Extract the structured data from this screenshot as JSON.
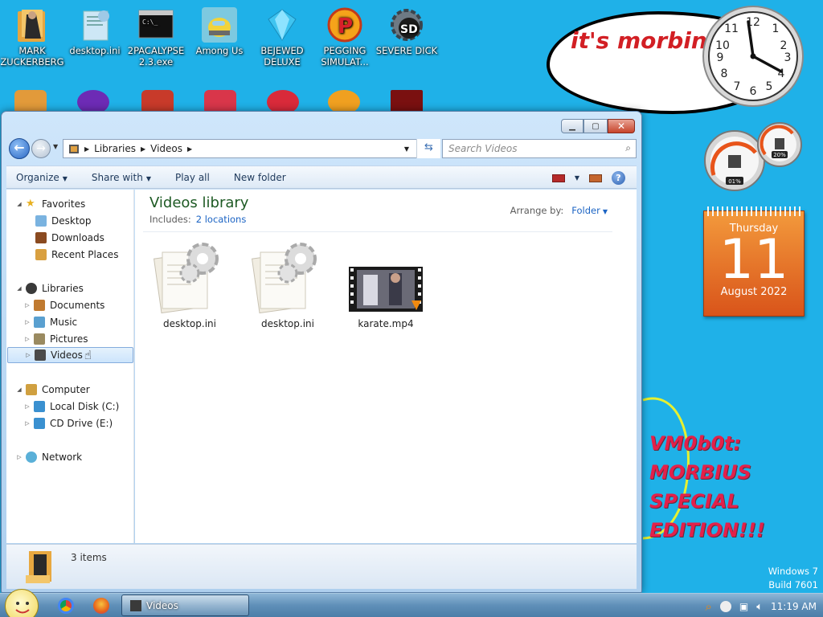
{
  "desktop": {
    "icons": [
      {
        "label": "MARK ZUCKERBERG",
        "icon": "folder-photo-icon"
      },
      {
        "label": "desktop.ini",
        "icon": "settings-file-icon"
      },
      {
        "label": "2PACALYPSE 2.3.exe",
        "icon": "console-icon"
      },
      {
        "label": "Among Us",
        "icon": "among-us-icon"
      },
      {
        "label": "BEJEWED DELUXE",
        "icon": "gem-icon"
      },
      {
        "label": "PEGGING SIMULAT...",
        "icon": "peggle-icon"
      },
      {
        "label": "SEVERE DICK",
        "icon": "sd-gear-icon"
      }
    ],
    "gadgets": {
      "bubble_text": "it's morbin",
      "clock_time": "11:19",
      "cpu_meter": "01%",
      "mem_meter": "20%",
      "calendar": {
        "weekday": "Thursday",
        "day": "11",
        "month_year": "August 2022"
      }
    },
    "scrawl_lines": [
      "VM0b0t:",
      "MORBIUS",
      "SPECIAL",
      "EDITION!!!"
    ],
    "watermark": {
      "line1": "Windows 7",
      "line2": "Build 7601"
    }
  },
  "explorer": {
    "address": {
      "root": "Libraries",
      "current": "Videos"
    },
    "search_placeholder": "Search Videos",
    "toolbar": {
      "organize": "Organize",
      "share": "Share with",
      "play": "Play all",
      "new_folder": "New folder"
    },
    "nav": {
      "favorites": "Favorites",
      "desktop": "Desktop",
      "downloads": "Downloads",
      "recent": "Recent Places",
      "libraries": "Libraries",
      "documents": "Documents",
      "music": "Music",
      "pictures": "Pictures",
      "videos": "Videos",
      "computer": "Computer",
      "local_disk": "Local Disk (C:)",
      "cd_drive": "CD Drive (E:)",
      "network": "Network"
    },
    "library_title": "Videos library",
    "includes_label": "Includes:",
    "includes_link": "2 locations",
    "arrange_label": "Arrange by:",
    "arrange_value": "Folder",
    "files": [
      {
        "name": "desktop.ini",
        "type": "ini"
      },
      {
        "name": "desktop.ini",
        "type": "ini"
      },
      {
        "name": "karate.mp4",
        "type": "video"
      }
    ],
    "status": "3 items"
  },
  "taskbar": {
    "task_label": "Videos",
    "time": "11:19 AM"
  },
  "colors": {
    "desktop_bg": "#1fb1e8",
    "title_green": "#1e5a24",
    "link_blue": "#1c64c4",
    "bubble_red": "#d21f24",
    "calendar_orange": "#e06a22"
  }
}
